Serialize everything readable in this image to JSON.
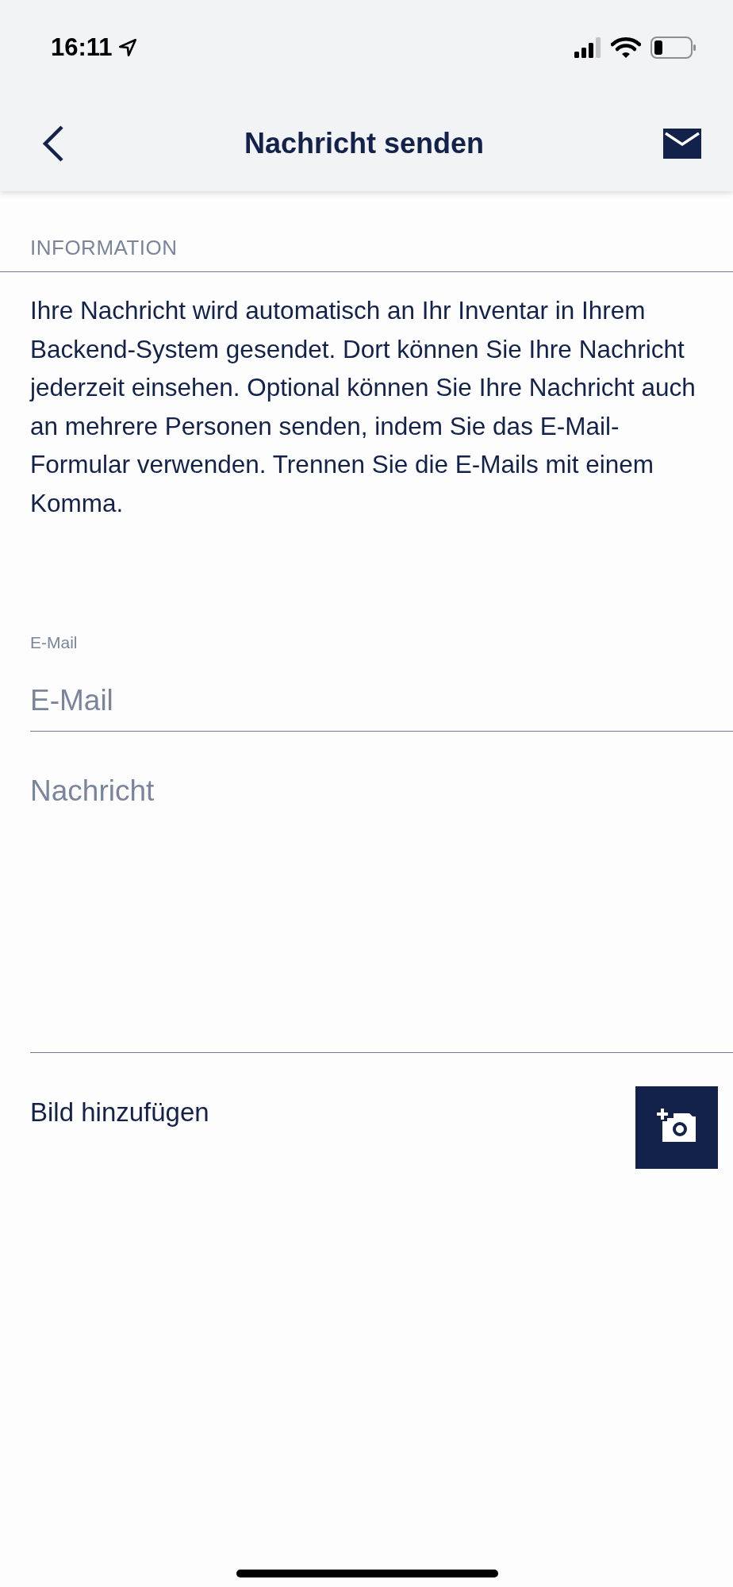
{
  "status_bar": {
    "time": "16:11"
  },
  "header": {
    "title": "Nachricht senden"
  },
  "information": {
    "heading": "INFORMATION",
    "text": "Ihre Nachricht wird automatisch an Ihr Inventar in Ihrem Backend-System gesendet. Dort können Sie Ihre Nachricht jederzeit einsehen. Optional können Sie Ihre Nachricht auch an mehrere Personen senden, indem Sie das E-Mail-Formular verwenden. Trennen Sie die E-Mails mit einem Komma."
  },
  "email_field": {
    "label": "E-Mail",
    "placeholder": "E-Mail"
  },
  "message_field": {
    "placeholder": "Nachricht"
  },
  "add_image": {
    "label": "Bild hinzufügen"
  }
}
